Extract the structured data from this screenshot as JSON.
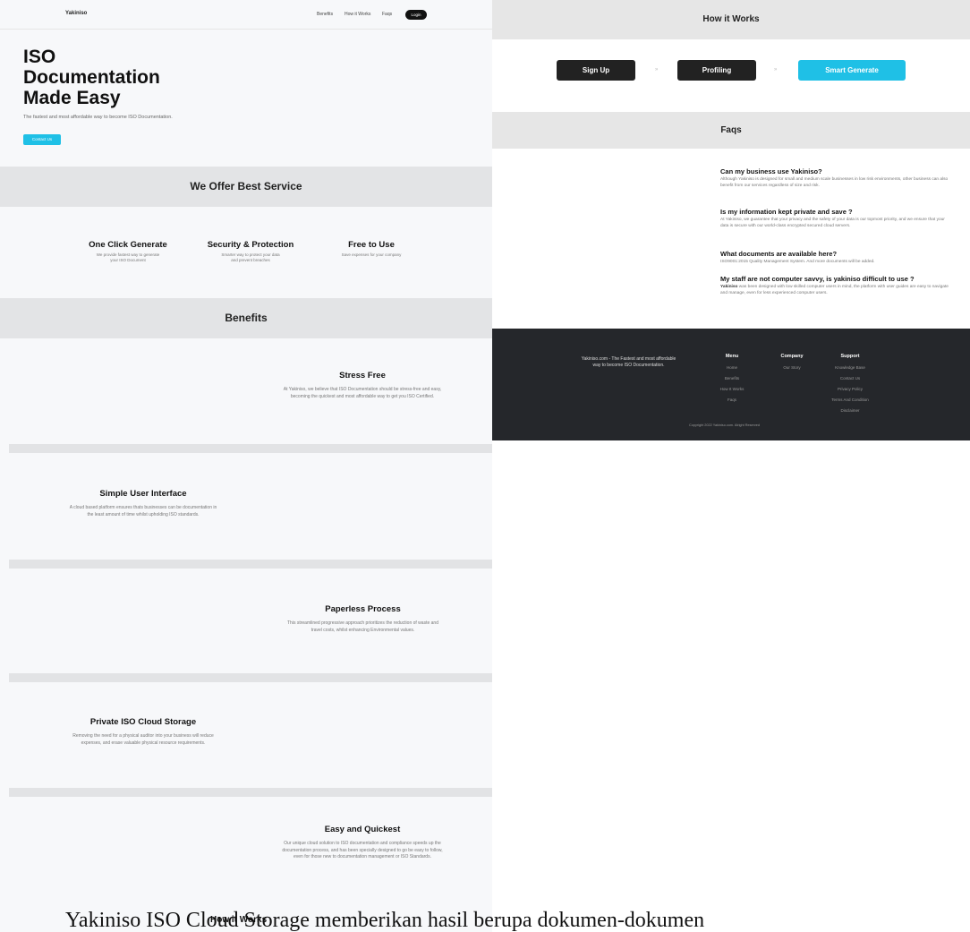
{
  "nav": {
    "brand": "Yakiniso",
    "links": [
      "Benefits",
      "How it Works",
      "Faqs"
    ],
    "login": "Login"
  },
  "hero": {
    "title_lines": [
      "ISO",
      "Documentation",
      "Made Easy"
    ],
    "subtitle": "The fastest and most affordable way to become ISO Documentation.",
    "cta": "Contact Us"
  },
  "services": {
    "heading": "We Offer Best Service",
    "items": [
      {
        "title": "One Click Generate",
        "desc": "We provide fastest way to generate your ISO Document"
      },
      {
        "title": "Security & Protection",
        "desc": "Smarter way to protect your data and prevent breaches"
      },
      {
        "title": "Free to Use",
        "desc": "Save expenses for your company"
      }
    ]
  },
  "benefits": {
    "heading": "Benefits",
    "items": [
      {
        "title": "Stress Free",
        "desc": "At Yakiniso, we believe that ISO Documentation should be stress-free and easy, becoming the quickest and most affordable way to get you ISO Certified."
      },
      {
        "title": "Simple User Interface",
        "desc": "A cloud based platform ensures thats businesses can be documentation in the least amount of time whilst upholding ISO standards."
      },
      {
        "title": "Paperless Process",
        "desc": "This streamlined progressive approach prioritizes the reduction of waste and travel costs, whilst enhancing Environmental values."
      },
      {
        "title": "Private ISO Cloud Storage",
        "desc": "Removing the need for a physical auditor into your business will reduce expenses, and erase valuable physical resource requirements."
      },
      {
        "title": "Easy and Quickest",
        "desc": "Our unique cloud solution to ISO documentation and compliance speeds up the documentation process, and has been specially designed to go be easy to follow, even for those new to documentation management or ISO Standards."
      }
    ]
  },
  "how": {
    "heading": "How it Works",
    "steps": [
      "Sign Up",
      "Profiling",
      "Smart Generate"
    ],
    "arrow": "»"
  },
  "faqs": {
    "heading": "Faqs",
    "items": [
      {
        "q": "Can my business use Yakiniso?",
        "a": "Although Yakiniso is designed for small and medium scale businesses in low risk environments, other business can also benefit from our services regardless of size and risk."
      },
      {
        "q": "Is my information kept private and save ?",
        "a": "At Yakiniso, we guarantee that your privacy and the safety of your data is our topmost priority, and we ensure that your data is secure with our world-class encrypted secured cloud servers."
      },
      {
        "q": "What documents are available here?",
        "a": "ISO9001:2015 Quality Management System. And more documents will be added."
      },
      {
        "q": "My staff are not computer savvy, is yakiniso difficult to use ?",
        "a_bold": "Yakiniso",
        "a": " was been designed with low skilled computer users in mind, the platform with user guides are easy to navigate and manage, even for less experienced computer users."
      }
    ]
  },
  "footer": {
    "about": "Yakiniso.com - The Fastest and most affordable way to become ISO Documentation.",
    "menu": {
      "heading": "Menu",
      "links": [
        "Home",
        "Benefits",
        "How It Works",
        "Faqs"
      ]
    },
    "company": {
      "heading": "Company",
      "links": [
        "Our Story"
      ]
    },
    "support": {
      "heading": "Support",
      "links": [
        "Knowledge Base",
        "Contact Us",
        "Privacy Policy",
        "Terms And Condition",
        "Disclaimer"
      ]
    },
    "copyright": "Copyright 2022 Yakiniso.com. Alright Reserved"
  },
  "caption": {
    "text": "Yakiniso ISO Cloud Storage memberikan hasil berupa dokumen-dokumen",
    "overlay": "How it Works"
  },
  "colors": {
    "accent": "#1fc0e6",
    "dark_button": "#222222",
    "footer_bg": "#25272b",
    "band_bg": "#e3e4e6"
  }
}
